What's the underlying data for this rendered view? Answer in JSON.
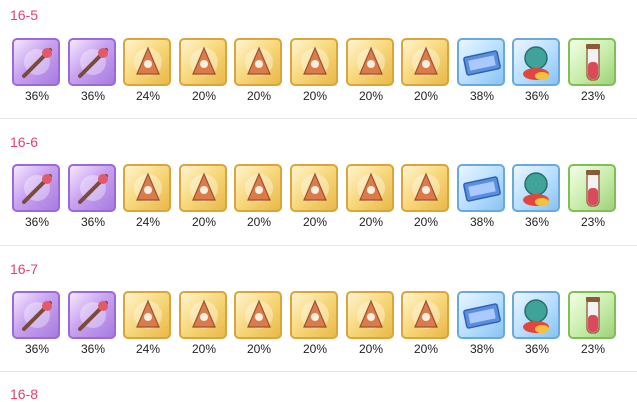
{
  "stages": [
    {
      "title": "16-5",
      "items": [
        {
          "icon": "staff-equipment-icon",
          "rarity": "purple",
          "drop": "36%"
        },
        {
          "icon": "red-scroll-equipment-icon",
          "rarity": "purple",
          "drop": "36%"
        },
        {
          "icon": "red-armor-equipment-icon",
          "rarity": "gold",
          "drop": "24%"
        },
        {
          "icon": "white-robe-equipment-icon",
          "rarity": "gold",
          "drop": "20%"
        },
        {
          "icon": "white-boots-equipment-icon",
          "rarity": "gold",
          "drop": "20%"
        },
        {
          "icon": "pendant-equipment-icon",
          "rarity": "gold",
          "drop": "20%"
        },
        {
          "icon": "flame-staff-equipment-icon",
          "rarity": "gold",
          "drop": "20%"
        },
        {
          "icon": "mace-equipment-icon",
          "rarity": "gold",
          "drop": "20%"
        },
        {
          "icon": "blue-ticket-icon",
          "rarity": "blue",
          "drop": "38%"
        },
        {
          "icon": "orb-potion-icon",
          "rarity": "blue",
          "drop": "36%"
        },
        {
          "icon": "vial-icon",
          "rarity": "green",
          "drop": "23%"
        }
      ]
    },
    {
      "title": "16-6",
      "items": [
        {
          "icon": "dagger-equipment-icon",
          "rarity": "purple",
          "drop": "36%"
        },
        {
          "icon": "bow-equipment-icon",
          "rarity": "purple",
          "drop": "36%"
        },
        {
          "icon": "green-outfit-equipment-icon",
          "rarity": "gold",
          "drop": "24%"
        },
        {
          "icon": "red-gauntlet-equipment-icon",
          "rarity": "gold",
          "drop": "20%"
        },
        {
          "icon": "orange-vest-equipment-icon",
          "rarity": "gold",
          "drop": "20%"
        },
        {
          "icon": "amulet-equipment-icon",
          "rarity": "gold",
          "drop": "20%"
        },
        {
          "icon": "sword-equipment-icon",
          "rarity": "gold",
          "drop": "20%"
        },
        {
          "icon": "greatsword-equipment-icon",
          "rarity": "gold",
          "drop": "20%"
        },
        {
          "icon": "blue-ticket-icon",
          "rarity": "blue",
          "drop": "38%"
        },
        {
          "icon": "orb-potion-icon",
          "rarity": "blue",
          "drop": "36%"
        },
        {
          "icon": "vial-icon",
          "rarity": "green",
          "drop": "23%"
        }
      ]
    },
    {
      "title": "16-7",
      "items": [
        {
          "icon": "wand-equipment-icon",
          "rarity": "purple",
          "drop": "36%"
        },
        {
          "icon": "crescent-charm-equipment-icon",
          "rarity": "purple",
          "drop": "36%"
        },
        {
          "icon": "fire-cape-equipment-icon",
          "rarity": "gold",
          "drop": "24%"
        },
        {
          "icon": "white-dress-equipment-icon",
          "rarity": "gold",
          "drop": "20%"
        },
        {
          "icon": "purple-gown-equipment-icon",
          "rarity": "gold",
          "drop": "20%"
        },
        {
          "icon": "bracelet-equipment-icon",
          "rarity": "gold",
          "drop": "20%"
        },
        {
          "icon": "rod-equipment-icon",
          "rarity": "gold",
          "drop": "20%"
        },
        {
          "icon": "longbow-equipment-icon",
          "rarity": "gold",
          "drop": "20%"
        },
        {
          "icon": "blue-ticket-icon",
          "rarity": "blue",
          "drop": "38%"
        },
        {
          "icon": "orb-potion-icon",
          "rarity": "blue",
          "drop": "36%"
        },
        {
          "icon": "vial-icon",
          "rarity": "green",
          "drop": "23%"
        }
      ]
    },
    {
      "title": "16-8",
      "items": []
    }
  ],
  "colors": {
    "title": "#e0446e",
    "purple": "#9a6ad8",
    "gold": "#d8a63a",
    "blue": "#6aa9e0",
    "green": "#7fbf55"
  }
}
